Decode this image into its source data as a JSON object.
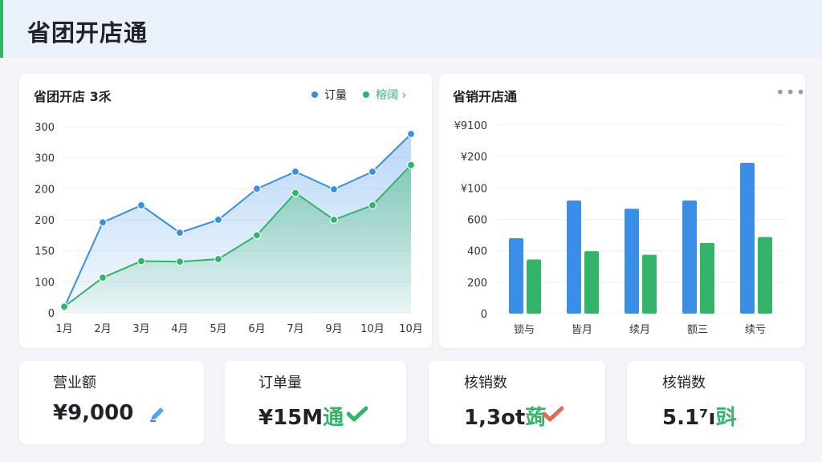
{
  "header": {
    "title": "省团开店通"
  },
  "line_card": {
    "title": "省团开店 3乑",
    "legend": [
      {
        "label": "订量",
        "color": "#3a8ee6"
      },
      {
        "label": "榕阔 ›",
        "color": "#34b36b"
      }
    ]
  },
  "bar_card": {
    "title": "省销开店通",
    "more_icon": "more-dots-icon"
  },
  "kpis": [
    {
      "label": "营业额",
      "value": "¥9,000",
      "suffix": "",
      "icon": "pencil-icon",
      "icon_color": "#3a8ee6"
    },
    {
      "label": "订单量",
      "value": "¥15M",
      "suffix": "通",
      "icon": "check-icon",
      "icon_color": "#34b36b"
    },
    {
      "label": "核销数",
      "value": "1,3ot",
      "suffix": "蒟",
      "icon": "check-icon",
      "icon_color": "#e06a5a"
    },
    {
      "label": "核销数",
      "value": "5.1⁷ı",
      "suffix": "㪷",
      "icon": "",
      "icon_color": ""
    }
  ],
  "chart_data": [
    {
      "type": "area",
      "title": "省团开店 3乑",
      "categories": [
        "1月",
        "2月",
        "3月",
        "4月",
        "5月",
        "6月",
        "7月",
        "9月",
        "10月",
        "10月"
      ],
      "y_tick_labels": [
        "0",
        "100",
        "150",
        "200",
        "200",
        "300",
        "300"
      ],
      "series": [
        {
          "name": "订量",
          "color": "#3a8ee6",
          "values": [
            10,
            175,
            208,
            155,
            180,
            240,
            273,
            239,
            273,
            346
          ]
        },
        {
          "name": "榕阔",
          "color": "#34b36b",
          "values": [
            12,
            68,
            100,
            99,
            104,
            150,
            232,
            180,
            208,
            286
          ]
        }
      ],
      "grid": true
    },
    {
      "type": "bar",
      "title": "省销开店通",
      "categories": [
        "锁与",
        "皆月",
        "续月",
        "额三",
        "续亏"
      ],
      "y_tick_labels": [
        "0",
        "200",
        "400",
        "600",
        "¥100",
        "¥200",
        "¥9100"
      ],
      "series": [
        {
          "color": "#3a8ee6",
          "values": [
            640,
            960,
            890,
            960,
            1280
          ]
        },
        {
          "color": "#34b36b",
          "values": [
            460,
            530,
            500,
            600,
            650
          ]
        }
      ],
      "grid": true
    }
  ]
}
